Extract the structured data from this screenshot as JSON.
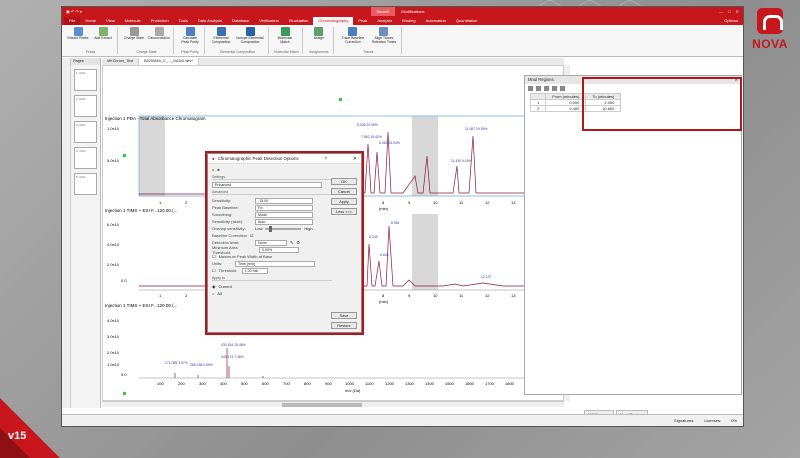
{
  "slide": {
    "version": "v15",
    "brand": "NOVA"
  },
  "app": {
    "context_tabs": [
      "Search",
      "Modifications"
    ],
    "window_controls": [
      "—",
      "□",
      "✕"
    ],
    "tabs": [
      "File",
      "Home",
      "View",
      "Molecule",
      "Prediction",
      "Tools",
      "Data Analysis",
      "Database",
      "Verification",
      "Elucidation",
      "Chromatography",
      "Peak",
      "Analysis",
      "Binding",
      "Automation",
      "Quantitation"
    ],
    "active_tab": "Chromatography",
    "user": "Options"
  },
  "ribbon": [
    {
      "group": "Peaks",
      "buttons": [
        "Extract Peaks",
        "Add Extract"
      ]
    },
    {
      "group": "Charge State",
      "buttons": [
        "Charge State",
        "Deconvolution"
      ]
    },
    {
      "group": "Peak Purity",
      "buttons": [
        "Calculate Peak Purity"
      ]
    },
    {
      "group": "Elemental Composition",
      "buttons": [
        "Elemental Composition",
        "Isotope Elemental Composition"
      ]
    },
    {
      "group": "Molecular Match",
      "buttons": [
        "Molecular Match"
      ]
    },
    {
      "group": "Assignments",
      "buttons": [
        "Assign"
      ]
    },
    {
      "group": "Traces",
      "buttons": [
        "Trace Baseline Correction",
        "Align Traces Retention Times"
      ]
    }
  ],
  "pages_panel": {
    "title": "Pages",
    "thumbs": [
      "1. COL",
      "2. COL",
      "3. COL",
      "4. COL",
      "5. COL"
    ]
  },
  "doc_tabs": [
    "MKChrom_Test",
    "B0259MA_C_..._GADG.dev*"
  ],
  "spectra": [
    {
      "title": "Injection 1  PDA - Total Absorbance Chromatogram",
      "yticks": [
        "1.0x10",
        "5.0x10"
      ],
      "xticks": [
        "1",
        "2",
        "8",
        "9",
        "10",
        "11",
        "12",
        "13",
        "14"
      ],
      "xlabel": "(min)",
      "labels": [
        "8.006\n20.05%",
        "7.862\n15.42%",
        "8.382\n16.04%",
        "11.957\n19.55%",
        "11.430\n4.19%"
      ]
    },
    {
      "title": "Injection 1  TIMS + ESI F...120.00 (...",
      "yticks": [
        "6.0x10",
        "4.0x10",
        "2.0x10",
        "0.0"
      ],
      "xticks": [
        "1",
        "2",
        "8",
        "9",
        "10",
        "11",
        "12",
        "13",
        "14"
      ],
      "xlabel": "(min)",
      "labels": [
        "8.981",
        "8.245",
        "8.645",
        "8.086",
        "12.137"
      ]
    },
    {
      "title": "Injection 1  TIMS + ESI F...120.00 (...",
      "yticks": [
        "4.0x10",
        "3.0x10",
        "2.0x10",
        "1.0x10",
        "0.0"
      ],
      "xticks": [
        "100",
        "200",
        "300",
        "400",
        "500",
        "600",
        "700",
        "800",
        "900",
        "1000",
        "1100",
        "1200",
        "1300",
        "1400",
        "1500",
        "1600",
        "1700",
        "1800",
        "1900",
        "2000"
      ],
      "xlabel": "m/z (Da)",
      "labels": [
        "171.085\n3.57%",
        "265.138\n0.89%",
        "430.164\n25.46%",
        "440.174\n7.48%"
      ]
    }
  ],
  "dialog": {
    "title": "Chromatographic Peak Detection Options",
    "help": "?",
    "close": "✕",
    "settings_label": "Settings",
    "settings_value": "Enhanced",
    "advanced_label": "Advanced",
    "fields": [
      {
        "label": "Sensitivity:",
        "value": "-15.00"
      },
      {
        "label": "Peak Baseline:",
        "value": "Fix"
      },
      {
        "label": "Smoothing:",
        "value": "Mode"
      },
      {
        "label": "Sensitivity (slide):",
        "value": "Auto"
      }
    ],
    "overlap_label": "Overlap sensitivity:",
    "overlap_low": "Low",
    "overlap_high": "High",
    "baseline_correction": "Baseline Correction",
    "detection_level_label": "Detection level:",
    "detection_level_value": "None",
    "min_area_label": "Minimum Area Threshold:",
    "min_area_value": "0.00%",
    "max_width_label": "Maximum Peak Width at Base",
    "units_label": "Units:",
    "units_value": "Time (min)",
    "threshold_label": "Threshold",
    "threshold_value": "1.00 min",
    "apply_to_label": "Apply to",
    "apply_options": [
      "Current",
      "All"
    ],
    "buttons": [
      "OK",
      "Cancel",
      "Apply",
      "Less <<<"
    ],
    "save_button": "Save",
    "restore_button": "Restore"
  },
  "regions_panel": {
    "title": "Mnul Regions",
    "columns": [
      "From (minutes)",
      "To (minutes)"
    ],
    "rows": [
      {
        "idx": "1",
        "from": "0.000",
        "to": "2.000"
      },
      {
        "idx": "2",
        "from": "9.400",
        "to": "10.600"
      }
    ]
  },
  "bottom_tabs": [
    "MS Browser",
    "Mnul Regions"
  ],
  "status": {
    "signatures": "Signatures:",
    "licenses": "Licenses:",
    "zoom": "0%"
  }
}
